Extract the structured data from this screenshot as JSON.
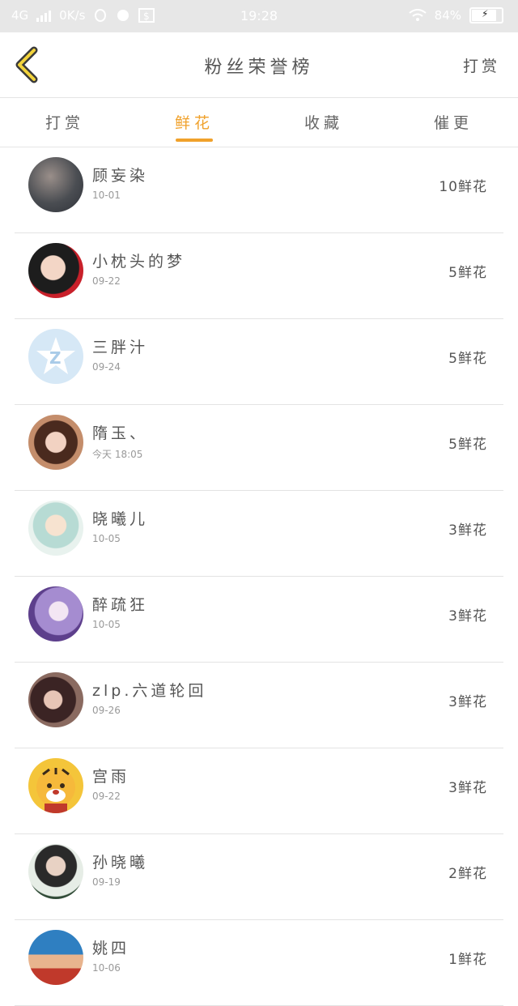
{
  "status_bar": {
    "network": "4G",
    "speed": "0K/s",
    "time": "19:28",
    "battery": "84%"
  },
  "header": {
    "title": "粉丝荣誉榜",
    "action_label": "打赏"
  },
  "tabs": [
    {
      "label": "打赏",
      "active": false
    },
    {
      "label": "鲜花",
      "active": true
    },
    {
      "label": "收藏",
      "active": false
    },
    {
      "label": "催更",
      "active": false
    }
  ],
  "accent_color": "#f0a12b",
  "fans": [
    {
      "name": "顾妄染",
      "date": "10-01",
      "count": "10鲜花"
    },
    {
      "name": "小枕头的梦",
      "date": "09-22",
      "count": "5鲜花"
    },
    {
      "name": "三胖汁",
      "date": "09-24",
      "count": "5鲜花"
    },
    {
      "name": "隋玉、",
      "date": "今天 18:05",
      "count": "5鲜花"
    },
    {
      "name": "晓曦儿",
      "date": "10-05",
      "count": "3鲜花"
    },
    {
      "name": "醉疏狂",
      "date": "10-05",
      "count": "3鲜花"
    },
    {
      "name": "zlp.六道轮回",
      "date": "09-26",
      "count": "3鲜花"
    },
    {
      "name": "宫雨",
      "date": "09-22",
      "count": "3鲜花"
    },
    {
      "name": "孙晓曦",
      "date": "09-19",
      "count": "2鲜花"
    },
    {
      "name": "姚四",
      "date": "10-06",
      "count": "1鲜花"
    }
  ]
}
